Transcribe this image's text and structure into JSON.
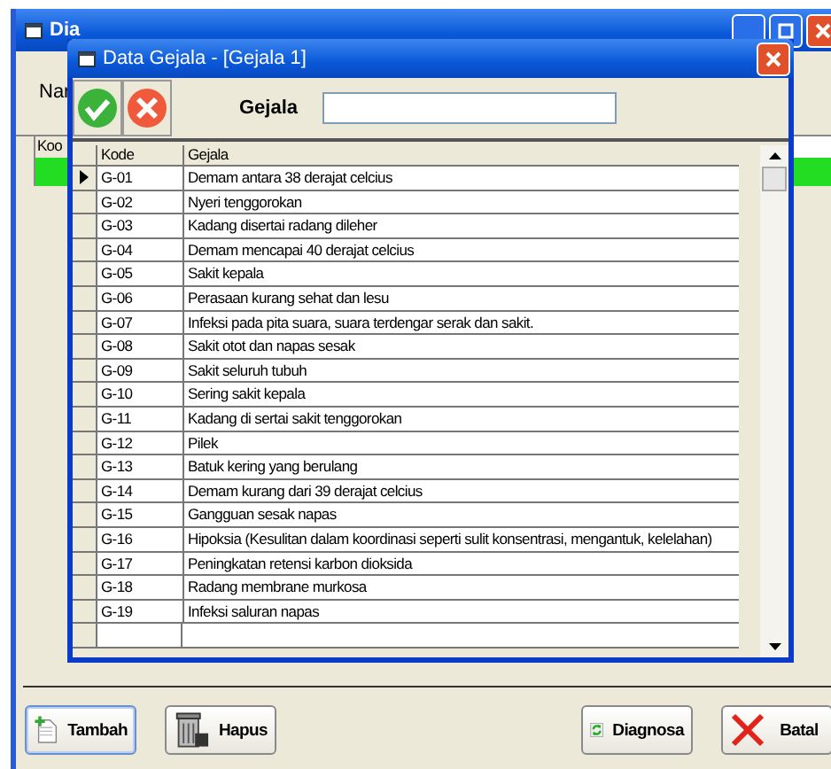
{
  "background_window": {
    "title": "Dia",
    "name_label": "Nar",
    "grid_column": "Koo",
    "buttons": [
      {
        "label": "Tambah",
        "kind": "add"
      },
      {
        "label": "Hapus",
        "kind": "delete"
      },
      {
        "label": "Diagnosa",
        "kind": "diagnose"
      },
      {
        "label": "Batal",
        "kind": "cancel"
      }
    ]
  },
  "dialog": {
    "title": "Data Gejala - [Gejala 1]",
    "field": {
      "label": "Gejala"
    },
    "table": {
      "columns": [
        "Kode",
        "Gejala"
      ],
      "rows": [
        {
          "kode": "G-01",
          "gejala": "Demam antara 38 derajat celcius",
          "selected": true
        },
        {
          "kode": "G-02",
          "gejala": "Nyeri tenggorokan",
          "selected": false
        },
        {
          "kode": "G-03",
          "gejala": "Kadang disertai radang dileher",
          "selected": false
        },
        {
          "kode": "G-04",
          "gejala": "Demam mencapai  40 derajat celcius",
          "selected": false
        },
        {
          "kode": "G-05",
          "gejala": "Sakit kepala",
          "selected": false
        },
        {
          "kode": "G-06",
          "gejala": "Perasaan kurang sehat dan lesu",
          "selected": false
        },
        {
          "kode": "G-07",
          "gejala": "Infeksi pada pita suara, suara terdengar serak dan sakit.",
          "selected": false
        },
        {
          "kode": "G-08",
          "gejala": "Sakit otot dan napas sesak",
          "selected": false
        },
        {
          "kode": "G-09",
          "gejala": "Sakit seluruh tubuh",
          "selected": false
        },
        {
          "kode": "G-10",
          "gejala": "Sering sakit kepala",
          "selected": false
        },
        {
          "kode": "G-11",
          "gejala": "Kadang di sertai sakit tenggorokan",
          "selected": false
        },
        {
          "kode": "G-12",
          "gejala": "Pilek",
          "selected": false
        },
        {
          "kode": "G-13",
          "gejala": "Batuk kering yang berulang",
          "selected": false
        },
        {
          "kode": "G-14",
          "gejala": "Demam kurang dari 39 derajat celcius",
          "selected": false
        },
        {
          "kode": "G-15",
          "gejala": "Gangguan sesak napas",
          "selected": false
        },
        {
          "kode": "G-16",
          "gejala": "Hipoksia (Kesulitan dalam koordinasi seperti sulit konsentrasi, mengantuk, kelelahan)",
          "selected": false
        },
        {
          "kode": "G-17",
          "gejala": "Peningkatan retensi karbon dioksida",
          "selected": false
        },
        {
          "kode": "G-18",
          "gejala": "Radang membrane murkosa",
          "selected": false
        },
        {
          "kode": "G-19",
          "gejala": "Infeksi saluran napas",
          "selected": false
        }
      ]
    }
  }
}
